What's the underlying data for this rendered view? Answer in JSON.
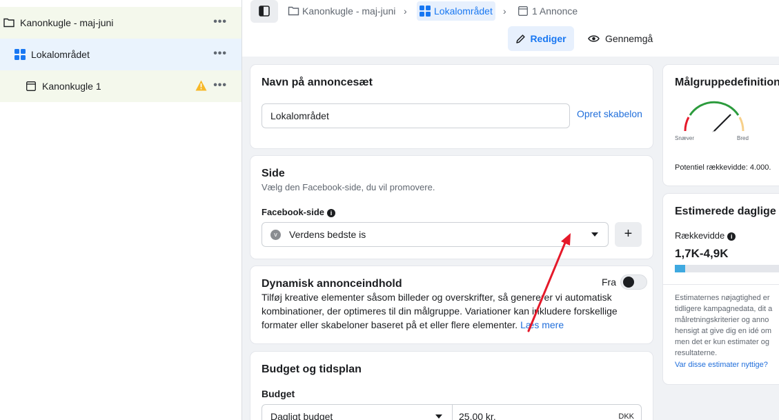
{
  "tree": {
    "campaign": "Kanonkugle - maj-juni",
    "adset": "Lokalområdet",
    "ad": "Kanonkugle 1",
    "more": "•••"
  },
  "breadcrumb": {
    "campaign": "Kanonkugle - maj-juni",
    "adset": "Lokalområdet",
    "ad": "1 Annonce"
  },
  "actions": {
    "edit": "Rediger",
    "review": "Gennemgå"
  },
  "name_card": {
    "title": "Navn på annoncesæt",
    "value": "Lokalområdet",
    "template_link": "Opret skabelon"
  },
  "page_card": {
    "title": "Side",
    "subtitle": "Vælg den Facebook-side, du vil promovere.",
    "field_label": "Facebook-side",
    "selected_page": "Verdens bedste is",
    "add": "+"
  },
  "dynamic_card": {
    "title": "Dynamisk annonceindhold",
    "toggle_label": "Fra",
    "toggle_on": false,
    "text1": "Tilføj kreative elementer såsom billeder og overskrifter, så genererer vi automatisk",
    "text2": "kombinationer, der optimeres til din målgruppe. Variationer kan inkludere forskellige",
    "text3": "formater eller skabeloner baseret på et eller flere elementer.",
    "more_link": "Læs mere"
  },
  "budget_card": {
    "title": "Budget og tidsplan",
    "budget_label": "Budget",
    "budget_type": "Dagligt budget",
    "amount": "25,00 kr.",
    "currency": "DKK"
  },
  "audience": {
    "title": "Målgruppedefinition",
    "narrow": "Snæver",
    "broad": "Bred",
    "reach": "Potentiel rækkevidde: 4.000."
  },
  "daily": {
    "title": "Estimerede daglige re",
    "reach_label": "Rækkevidde",
    "reach_value": "1,7K-4,9K",
    "reach_fraction": 0.04,
    "disclaimer": [
      "Estimaternes nøjagtighed er",
      "tidligere kampagnedata, dit a",
      "målretningskriterier og anno",
      "hensigt at give dig en idé om",
      "men det er kun estimater og",
      "resultaterne."
    ],
    "feedback_link": "Var disse estimater nyttige?"
  },
  "colors": {
    "accent": "#1877f2",
    "arrow": "#e5192a",
    "warning": "#f7b928"
  }
}
